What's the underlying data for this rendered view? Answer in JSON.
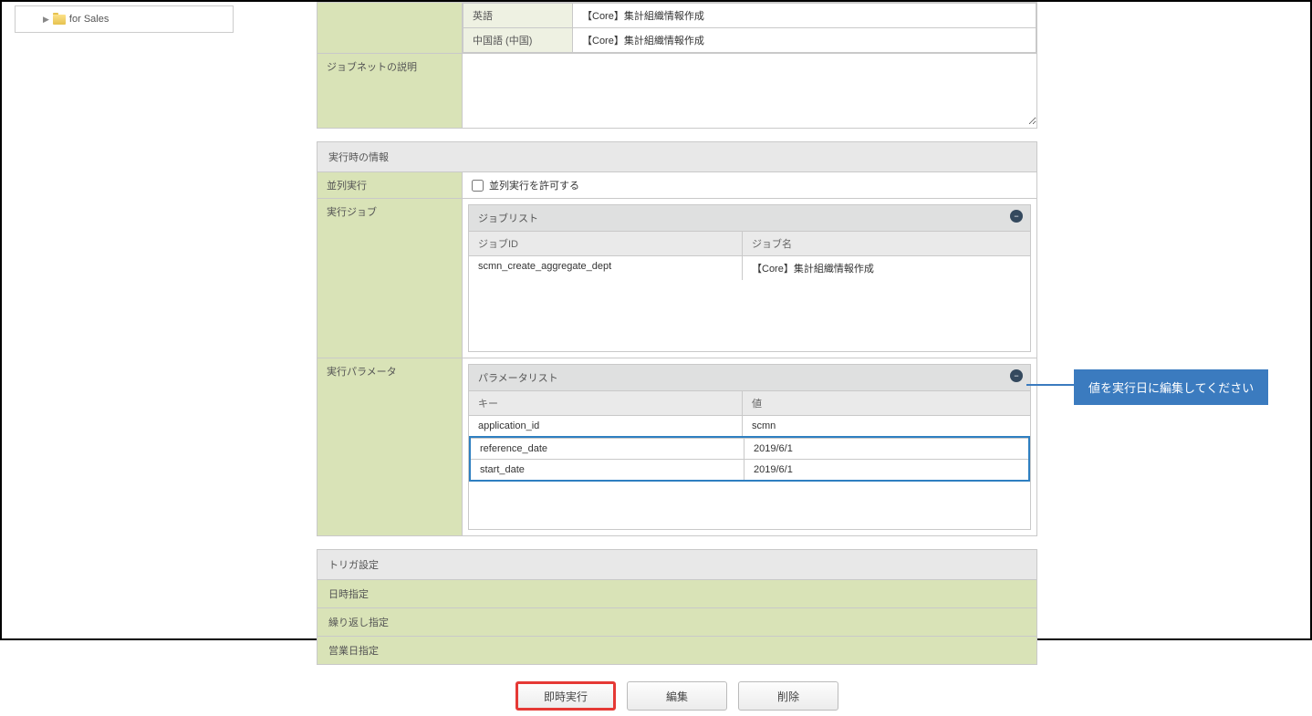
{
  "sidebar": {
    "tree_item": "for Sales"
  },
  "lang_rows": [
    {
      "label": "英語",
      "value": "【Core】集計組織情報作成"
    },
    {
      "label": "中国語 (中国)",
      "value": "【Core】集計組織情報作成"
    }
  ],
  "jobnet_desc_label": "ジョブネットの説明",
  "runtime_header": "実行時の情報",
  "parallel": {
    "label": "並列実行",
    "checkbox_label": "並列実行を許可する"
  },
  "exec_job": {
    "label": "実行ジョブ",
    "list_title": "ジョブリスト",
    "col_id": "ジョブID",
    "col_name": "ジョブ名",
    "rows": [
      {
        "id": "scmn_create_aggregate_dept",
        "name": "【Core】集計組織情報作成"
      }
    ]
  },
  "exec_param": {
    "label": "実行パラメータ",
    "list_title": "パラメータリスト",
    "col_key": "キー",
    "col_val": "値",
    "rows": [
      {
        "key": "application_id",
        "val": "scmn",
        "hl": false
      },
      {
        "key": "reference_date",
        "val": "2019/6/1",
        "hl": true
      },
      {
        "key": "start_date",
        "val": "2019/6/1",
        "hl": true
      }
    ]
  },
  "trigger": {
    "header": "トリガ設定",
    "rows": [
      "日時指定",
      "繰り返し指定",
      "営業日指定"
    ]
  },
  "buttons": {
    "run": "即時実行",
    "edit": "編集",
    "delete": "削除"
  },
  "callout": "値を実行日に編集してください"
}
